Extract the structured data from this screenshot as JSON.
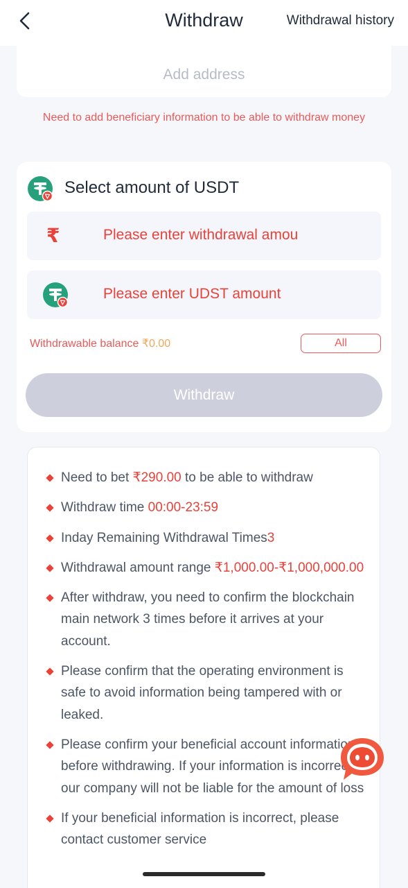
{
  "header": {
    "title": "Withdraw",
    "history_label": "Withdrawal history"
  },
  "address": {
    "add_label": "Add address"
  },
  "notice": "Need to add beneficiary information to be able to withdraw money",
  "amount": {
    "title": "Select amount of USDT",
    "currency_symbol": "₹",
    "inr_placeholder": "Please enter withdrawal amou",
    "usdt_placeholder": "Please enter UDST amount",
    "balance_label": "Withdrawable balance ",
    "balance_value": "₹0.00",
    "all_label": "All",
    "withdraw_label": "Withdraw"
  },
  "rules": {
    "r1_pre": "Need to bet ",
    "r1_val": "₹290.00",
    "r1_post": " to be able to withdraw",
    "r2_pre": "Withdraw time ",
    "r2_val": "00:00-23:59",
    "r3_pre": "Inday Remaining Withdrawal Times",
    "r3_val": "3",
    "r4_pre": "Withdrawal amount range ",
    "r4_val": "₹1,000.00-₹1,000,000.00",
    "r5": "After withdraw, you need to confirm the blockchain main network 3 times before it arrives at your account.",
    "r6": "Please confirm that the operating environment is safe to avoid information being tampered with or leaked.",
    "r7": "Please confirm your beneficial account information before withdrawing. If your information is incorrect, our company will not be liable for the amount of loss",
    "r8": "If your beneficial information is incorrect, please contact customer service"
  },
  "colors": {
    "accent": "#e8423a",
    "usdt_green": "#26a17b",
    "button_disabled": "#cdd0dc"
  }
}
